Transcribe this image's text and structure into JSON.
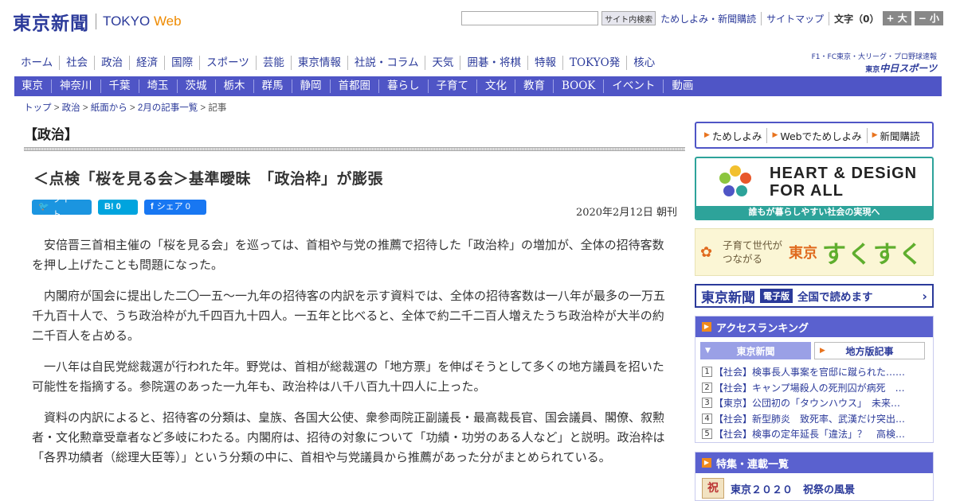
{
  "header": {
    "logo_ja": "東京新聞",
    "logo_en": "TOKYO",
    "logo_web": "Web",
    "search_button": "サイト内検索",
    "util_links": [
      "ためしよみ・新聞購読",
      "サイトマップ"
    ],
    "font_size_label": "文字（0）",
    "font_up": "+ 大",
    "font_down": "− 小"
  },
  "chunichi": {
    "top": "F1・FC東京・大リーグ・プロ野球速報",
    "small": "東京",
    "main": "中日スポーツ"
  },
  "global_nav": [
    "ホーム",
    "社会",
    "政治",
    "経済",
    "国際",
    "スポーツ",
    "芸能",
    "東京情報",
    "社説・コラム",
    "天気",
    "囲碁・将棋",
    "特報",
    "TOKYO発",
    "核心"
  ],
  "region_nav": [
    "東京",
    "神奈川",
    "千葉",
    "埼玉",
    "茨城",
    "栃木",
    "群馬",
    "静岡",
    "首都圏",
    "暮らし",
    "子育て",
    "文化",
    "教育",
    "BOOK",
    "イベント",
    "動画"
  ],
  "breadcrumb": {
    "items": [
      "トップ",
      "政治",
      "紙面から",
      "2月の記事一覧",
      "記事"
    ],
    "sep": " > "
  },
  "article": {
    "section": "【政治】",
    "title": "＜点検「桜を見る会＞基準曖昧　「政治枠」が膨張",
    "date": "2020年2月12日 朝刊",
    "share": {
      "tweet": "ツイート",
      "hatena": "B! 0",
      "fb": "シェア 0"
    },
    "paragraphs": [
      "安倍晋三首相主催の「桜を見る会」を巡っては、首相や与党の推薦で招待した「政治枠」の増加が、全体の招待客数を押し上げたことも問題になった。",
      "内閣府が国会に提出した二〇一五～一九年の招待客の内訳を示す資料では、全体の招待客数は一八年が最多の一万五千九百十人で、うち政治枠が九千四百九十四人。一五年と比べると、全体で約二千二百人増えたうち政治枠が大半の約二千百人を占める。",
      "一八年は自民党総裁選が行われた年。野党は、首相が総裁選の「地方票」を伸ばそうとして多くの地方議員を招いた可能性を指摘する。参院選のあった一九年も、政治枠は八千八百九十四人に上った。",
      "資料の内訳によると、招待客の分類は、皇族、各国大公使、衆参両院正副議長・最高裁長官、国会議員、閣僚、叙勲者・文化勲章受章者など多岐にわたる。内閣府は、招待の対象について「功績・功労のある人など」と説明。政治枠は「各界功績者（総理大臣等）」という分類の中に、首相や与党議員から推薦があった分がまとめられている。"
    ]
  },
  "sidebar": {
    "trial": [
      "ためしよみ",
      "Webでためしよみ",
      "新聞購読"
    ],
    "hdfa": {
      "line1": "HEART & DESiGN",
      "line2": "FOR ALL",
      "foot": "誰もが暮らしやすい社会の実現へ"
    },
    "sukusuku": {
      "tag1": "子育て世代が",
      "tag2": "つながる",
      "tokyo": "東京",
      "main": "すくすく"
    },
    "denshi": {
      "logo": "東京新聞",
      "badge": "電子版",
      "text": "全国で読めます"
    },
    "ranking": {
      "title": "アクセスランキング",
      "tabs": [
        "東京新聞",
        "地方版記事"
      ],
      "items": [
        "【社会】検事長人事案を官邸に蹴られた……",
        "【社会】キャンプ場殺人の死刑囚が病死　…",
        "【東京】公団初の「タウンハウス」　未来…",
        "【社会】新型肺炎　致死率、武漢だけ突出…",
        "【社会】検事の定年延長「違法」？　高検…"
      ]
    },
    "features": {
      "title": "特集・連載一覧",
      "items": [
        {
          "thumb": "祝",
          "title": "東京２０２０　祝祭の風景"
        }
      ]
    }
  },
  "colors": {
    "brand": "#2b3a9a",
    "nav_bar": "#4f55c6",
    "accent_orange": "#ee8a00",
    "hdfa_teal": "#2da39a"
  }
}
